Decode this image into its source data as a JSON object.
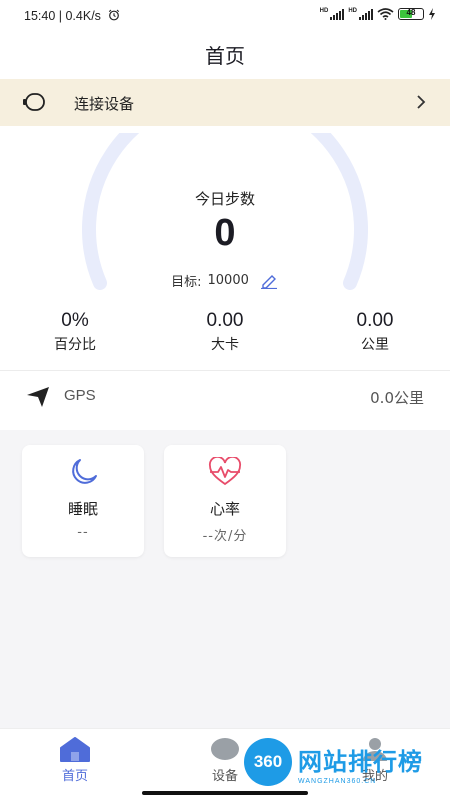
{
  "status_bar": {
    "time_speed": "15:40 | 0.4K/s",
    "alarm_icon": "alarm-icon",
    "signal_1": "HD",
    "signal_2": "HD",
    "wifi_icon": "wifi-icon",
    "battery_percent": "48",
    "charging_icon": "charging-icon"
  },
  "header": {
    "title": "首页"
  },
  "connect_bar": {
    "icon": "watch-icon",
    "label": "连接设备",
    "chevron": "chevron-right-icon"
  },
  "steps": {
    "title": "今日步数",
    "value": "0",
    "target_label": "目标:",
    "target_value": "10000",
    "edit_icon": "pencil-icon",
    "progress_fraction": 0
  },
  "stats": [
    {
      "value": "0%",
      "label": "百分比"
    },
    {
      "value": "0.00",
      "label": "大卡"
    },
    {
      "value": "0.00",
      "label": "公里"
    }
  ],
  "gps": {
    "icon": "navigation-arrow-icon",
    "label": "GPS",
    "value": "0.0公里"
  },
  "cards": [
    {
      "icon": "moon-icon",
      "title": "睡眠",
      "value": "--"
    },
    {
      "icon": "heart-rate-icon",
      "title": "心率",
      "value": "--次/分"
    }
  ],
  "tabs": [
    {
      "icon": "home-icon",
      "label": "首页",
      "active": true
    },
    {
      "icon": "device-icon",
      "label": "设备",
      "active": false
    },
    {
      "icon": "profile-icon",
      "label": "我的",
      "active": false
    }
  ],
  "watermark": {
    "badge": "360",
    "text": "网站排行榜",
    "sub": "WANGZHAN360.CN"
  },
  "colors": {
    "accent": "#4f6cd9",
    "gauge_track": "#e8ecfb",
    "connect_bar_bg": "#f6efde",
    "heart": "#e84c6a",
    "watermark": "#1e9be6"
  }
}
